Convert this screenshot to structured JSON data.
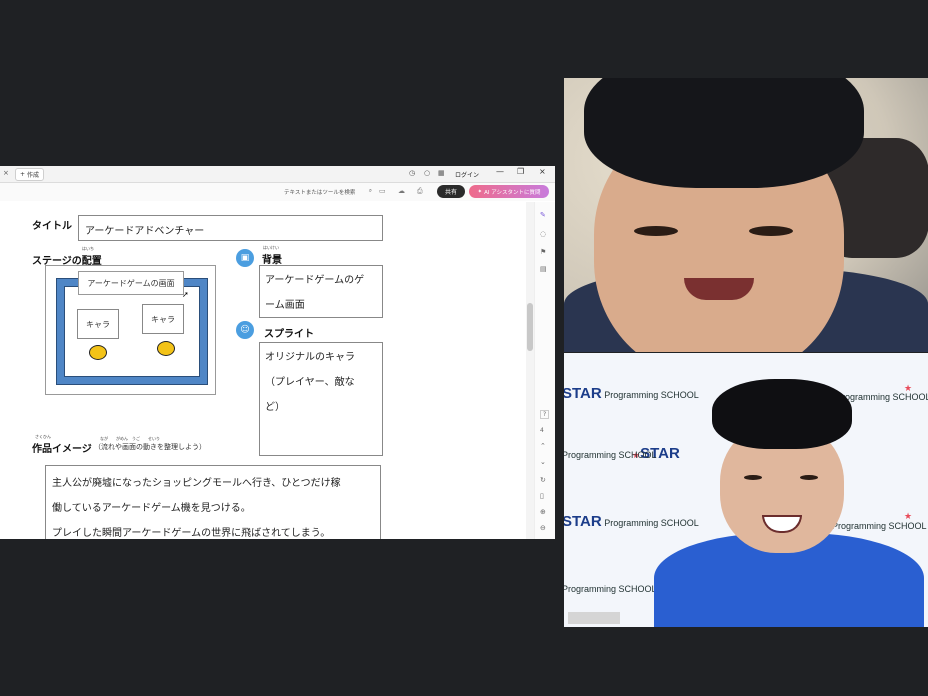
{
  "browser": {
    "close_glyph": "×",
    "new_tab_label": "作成",
    "new_tab_plus": "+",
    "login_label": "ログイン",
    "minimize_glyph": "—",
    "restore_glyph": "❐",
    "window_close_glyph": "×"
  },
  "toolbar": {
    "search_placeholder": "テキストまたはツールを検索",
    "share_label": "共有",
    "ai_label": "AI アシスタントに質問"
  },
  "doc": {
    "title_label": "タイトル",
    "title_value": "アーケードアドベンチャー",
    "stage_label": "ステージの配置",
    "stage_ruby": "はいち",
    "stage_screen_label": "アーケードゲームの画面",
    "chara_1": "キャラ",
    "chara_2": "キャラ",
    "background_label": "背景",
    "background_ruby": "はいけい",
    "background_value_1": "アーケードゲームのゲ",
    "background_value_2": "ーム画面",
    "sprite_label": "スプライト",
    "sprite_value_1": "オリジナルのキャラ",
    "sprite_value_2": "（プレイヤー、敵な",
    "sprite_value_3": "ど）",
    "image_label": "作品イメージ",
    "image_ruby": "さくひん",
    "image_hint": "（流れや画面の動きを整理しよう）",
    "image_hint_ruby": "なが　　がめん　うご　　せいり",
    "story_1": "主人公が廃墟になったショッピングモールへ行き、ひとつだけ稼",
    "story_2": "働しているアーケードゲーム機を見つける。",
    "story_3": "プレイした瞬間アーケードゲームの世界に飛ばされてしまう。"
  },
  "rail": {
    "page_number": "4",
    "help_glyph": "?"
  },
  "webcams": {
    "school_brand": "STAR",
    "school_name": "Programming SCHOOL"
  },
  "colors": {
    "share_bg": "#2b2b2b",
    "ai_gradient_start": "#ee6b8b",
    "ai_gradient_end": "#c87bdc",
    "stage_blue": "#4f86c6",
    "coin_yellow": "#f3c318",
    "brand_blue": "#1c3d8a",
    "brand_star": "#e84b5a"
  }
}
